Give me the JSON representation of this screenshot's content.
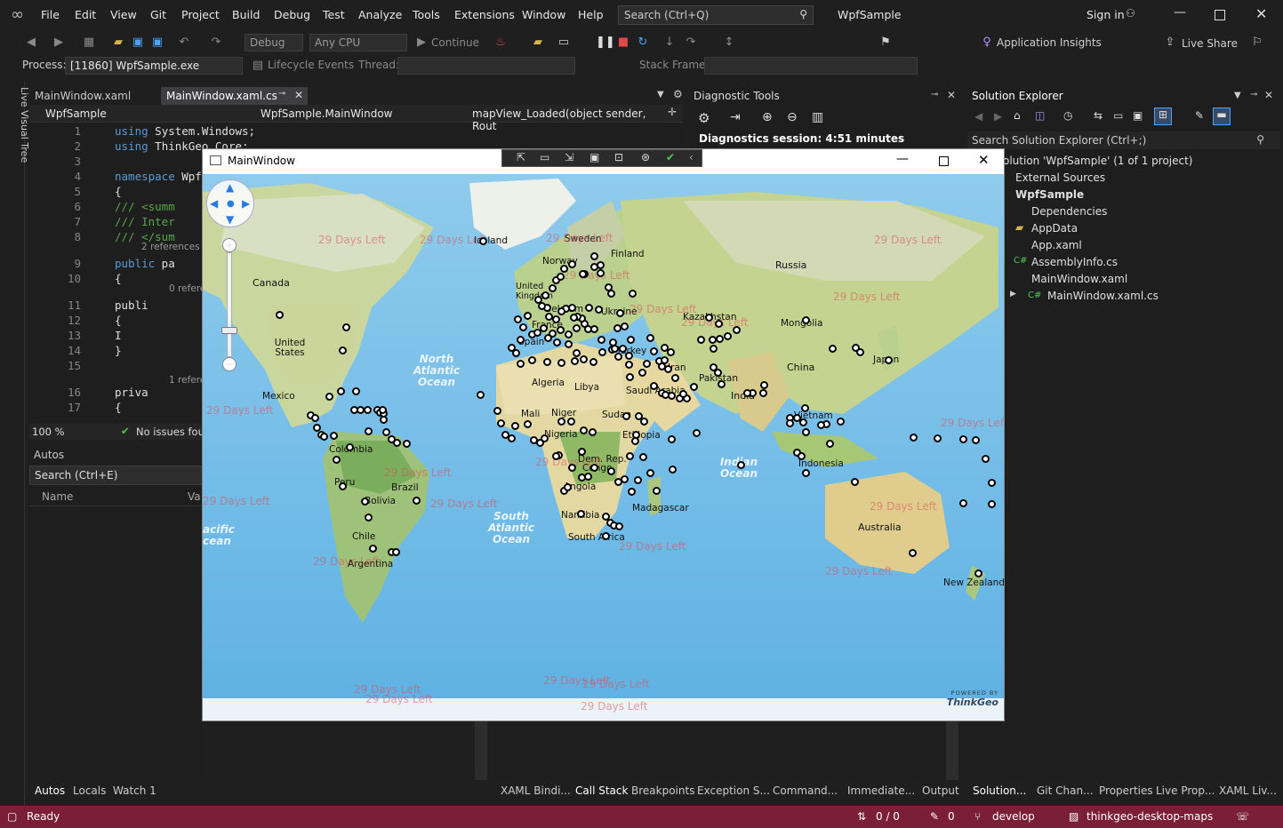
{
  "menu": {
    "items": [
      "File",
      "Edit",
      "View",
      "Git",
      "Project",
      "Build",
      "Debug",
      "Test",
      "Analyze",
      "Tools",
      "Extensions",
      "Window",
      "Help"
    ],
    "search_placeholder": "Search (Ctrl+Q)",
    "app_title": "WpfSample",
    "sign_in": "Sign in"
  },
  "toolbar": {
    "config": "Debug",
    "platform": "Any CPU",
    "continue": "Continue",
    "app_insights": "Application Insights",
    "live_share": "Live Share"
  },
  "toolbar2": {
    "process_label": "Process:",
    "process_value": "[11860] WpfSample.exe",
    "lifecycle": "Lifecycle Events",
    "thread_label": "Thread:",
    "stack_frame": "Stack Frame:"
  },
  "left_strip": {
    "label": "Live Visual Tree"
  },
  "editor": {
    "tabs": [
      "MainWindow.xaml",
      "MainWindow.xaml.cs"
    ],
    "nav": [
      "WpfSample",
      "WpfSample.MainWindow",
      "mapView_Loaded(object sender, Rout"
    ],
    "lines": [
      {
        "n": "1",
        "t": "using System.Windows;"
      },
      {
        "n": "2",
        "t": "using ThinkGeo.Core;"
      },
      {
        "n": "3",
        "t": ""
      },
      {
        "n": "4",
        "t": "namespace Wpf"
      },
      {
        "n": "5",
        "t": "{"
      },
      {
        "n": "6",
        "t": "    /// <summ"
      },
      {
        "n": "7",
        "t": "    /// Inter"
      },
      {
        "n": "8",
        "t": "    /// </sum"
      },
      {
        "n": "9",
        "t": "    public pa"
      },
      {
        "n": "10",
        "t": "    {"
      },
      {
        "n": "11",
        "t": "        publi"
      },
      {
        "n": "12",
        "t": "        {"
      },
      {
        "n": "13",
        "t": "            I"
      },
      {
        "n": "14",
        "t": "        }"
      },
      {
        "n": "15",
        "t": ""
      },
      {
        "n": "16",
        "t": "        priva"
      },
      {
        "n": "17",
        "t": "        {"
      }
    ],
    "refs": [
      "2 references",
      "0 refere",
      "1 refere"
    ],
    "zoom": "100 %",
    "issues": "No issues fou"
  },
  "autos": {
    "title": "Autos",
    "search": "Search (Ctrl+E)",
    "col_name": "Name",
    "col_value": "Va"
  },
  "diag": {
    "title": "Diagnostic Tools",
    "session": "Diagnostics session: 4:51 minutes"
  },
  "solution": {
    "title": "Solution Explorer",
    "search": "Search Solution Explorer (Ctrl+;)",
    "items": [
      "olution 'WpfSample' (1 of 1 project)",
      "External Sources",
      "WpfSample",
      "Dependencies",
      "AppData",
      "App.xaml",
      "AssemblyInfo.cs",
      "MainWindow.xaml",
      "MainWindow.xaml.cs"
    ]
  },
  "bottom_tabs_left": [
    "Autos",
    "Locals",
    "Watch 1"
  ],
  "bottom_tabs_mid": [
    "XAML Bindi...",
    "Call Stack",
    "Breakpoints",
    "Exception S...",
    "Command...",
    "Immediate...",
    "Output"
  ],
  "bottom_tabs_right": [
    "Solution...",
    "Git Chan...",
    "Properties",
    "Live Prop...",
    "XAML Liv..."
  ],
  "statusbar": {
    "ready": "Ready",
    "changes": "0 / 0",
    "pencil": "0",
    "branch": "develop",
    "repo": "thinkgeo-desktop-maps"
  },
  "mainwindow": {
    "title": "MainWindow",
    "countries": [
      "Canada",
      "United States",
      "Mexico",
      "Colombia",
      "Peru",
      "Brazil",
      "Bolivia",
      "Chile",
      "Argentina",
      "Iceland",
      "Sweden",
      "Finland",
      "Norway",
      "United Kingdom",
      "Belgium",
      "France",
      "Spain",
      "Ukraine",
      "Russia",
      "Kazakhstan",
      "Mongolia",
      "China",
      "Japan",
      "Turkey",
      "Iran",
      "Pakistan",
      "India",
      "Saudi Arabia",
      "Algeria",
      "Libya",
      "Mali",
      "Niger",
      "Sudan",
      "Ethiopia",
      "Nigeria",
      "Dem. Rep.",
      "Congo",
      "Angola",
      "Namibia",
      "South Africa",
      "Madagascar",
      "Vietnam",
      "Indonesia",
      "Australia",
      "New Zealand"
    ],
    "oceans": [
      "North Atlantic Ocean",
      "South Atlantic Ocean",
      "Indian Ocean",
      "Pacific Ocean"
    ],
    "watermark": "29 Days Left",
    "brand_top": "POWERED BY",
    "brand": "ThinkGeo"
  },
  "colors": {
    "status": "#7a1f36",
    "accent": "#3794ff",
    "poi": "#000000"
  }
}
